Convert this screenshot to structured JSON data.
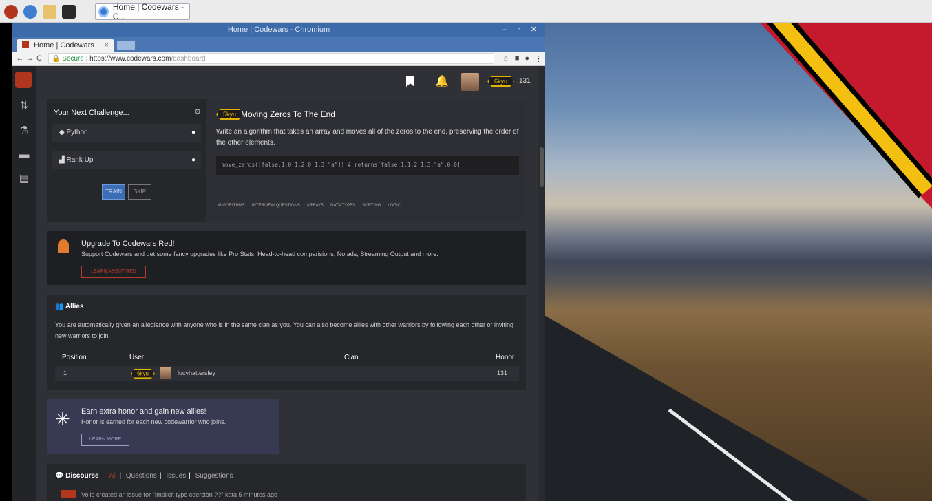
{
  "taskbar": {
    "task_label": "Home | Codewars - C..."
  },
  "window": {
    "title": "Home | Codewars - Chromium",
    "controls": "–  ▫  ✕",
    "tab_title": "Home | Codewars",
    "tab_close": "×",
    "url_secure": "Secure",
    "url_host": "https://www.codewars.com",
    "url_path": "/dashboard"
  },
  "topbar": {
    "rank": "6kyu",
    "honor": "131"
  },
  "challenge": {
    "header": "Your Next Challenge...",
    "language": "Python",
    "strategy": "Rank Up",
    "train_label": "TRAIN",
    "skip_label": "SKIP",
    "kata_rank": "5kyu",
    "kata_name": "Moving Zeros To The End",
    "description": "Write an algorithm that takes an array and moves all of the zeros to the end, preserving the order of the other elements.",
    "code": "move_zeros([false,1,0,1,2,0,1,3,\"a\"]) # returns[false,1,1,2,1,3,\"a\",0,0]",
    "tags": [
      "ALGORITHMS",
      "INTERVIEW QUESTIONS",
      "ARRAYS",
      "DATA TYPES",
      "SORTING",
      "LOGIC"
    ]
  },
  "upgrade": {
    "title": "Upgrade To Codewars Red!",
    "text": "Support Codewars and get some fancy upgrades like Pro Stats, Head-to-head comparisions, No ads, Streaming Output and more.",
    "button": "LEARN ABOUT RED"
  },
  "allies": {
    "title": "Allies",
    "text": "You are automatically given an allegiance with anyone who is in the same clan as you. You can also become allies with other warriors by following each other or inviting new warriors to join.",
    "columns": [
      "Position",
      "User",
      "Clan",
      "Honor"
    ],
    "rows": [
      {
        "position": "1",
        "rank": "6kyu",
        "user": "lucyhattersley",
        "clan": "",
        "honor": "131"
      }
    ]
  },
  "earn": {
    "title": "Earn extra honor and gain new allies!",
    "text": "Honor is earned for each new codewarrior who joins.",
    "button": "LEARN MORE"
  },
  "discourse": {
    "title": "Discourse",
    "filters": [
      "All",
      "Questions",
      "Issues",
      "Suggestions"
    ],
    "item": "Voile  created an issue for \"Implicit type coercion ??\" kata  5 minutes ago"
  }
}
